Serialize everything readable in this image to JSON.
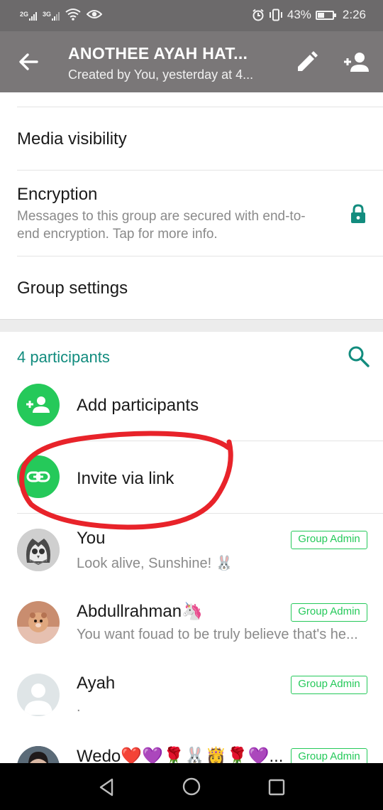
{
  "status_bar": {
    "network1": "2G",
    "network2": "3G",
    "battery": "43%",
    "time": "2:26",
    "icons": [
      "wifi-icon",
      "eye-icon",
      "alarm-icon",
      "vibrate-icon",
      "battery-icon"
    ]
  },
  "app_bar": {
    "title": "ANOTHEE AYAH HAT...",
    "subtitle": "Created by You, yesterday at 4...",
    "icons": [
      "back-arrow-icon",
      "pencil-icon",
      "add-person-icon"
    ]
  },
  "info": {
    "media_visibility": "Media visibility",
    "encryption_title": "Encryption",
    "encryption_desc": "Messages to this group are secured with end-to-end encryption. Tap for more info.",
    "group_settings": "Group settings"
  },
  "participants": {
    "header": "4 participants",
    "add_label": "Add participants",
    "invite_label": "Invite via link",
    "members": [
      {
        "name": "You",
        "status": "Look alive, Sunshine! 🐰",
        "badge": "Group Admin"
      },
      {
        "name": "Abdullrahman🦄",
        "status": "You want fouad to be truly believe that's he...",
        "badge": "Group Admin"
      },
      {
        "name": "Ayah",
        "status": ".",
        "badge": "Group Admin"
      },
      {
        "name": "Wedo❤️💜🌹🐰👸🌹💜...",
        "status": "",
        "badge": "Group Admin"
      }
    ]
  },
  "colors": {
    "accent": "#128c7e",
    "green": "#25c95a",
    "app_bar": "#7a7778",
    "status_bar": "#6c6a6b",
    "annotation": "#e8232a"
  }
}
